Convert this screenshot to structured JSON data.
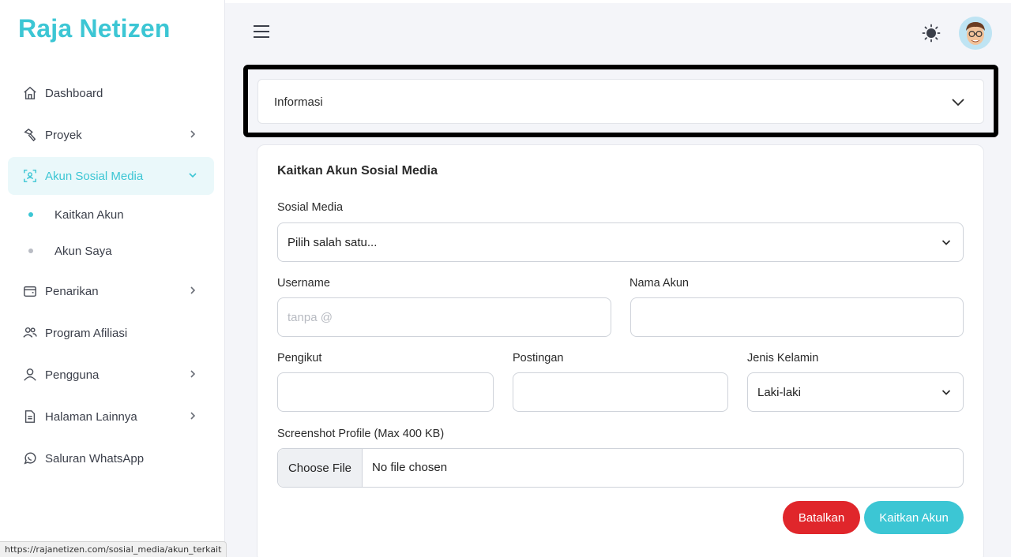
{
  "brand": "Raja Netizen",
  "sidebar": {
    "items": [
      {
        "label": "Dashboard",
        "icon": "home-icon"
      },
      {
        "label": "Proyek",
        "icon": "hammer-icon"
      },
      {
        "label": "Akun Sosial Media",
        "icon": "user-scan-icon"
      },
      {
        "label": "Penarikan",
        "icon": "wallet-icon"
      },
      {
        "label": "Program Afiliasi",
        "icon": "users-icon"
      },
      {
        "label": "Pengguna",
        "icon": "user-icon"
      },
      {
        "label": "Halaman Lainnya",
        "icon": "document-icon"
      },
      {
        "label": "Saluran WhatsApp",
        "icon": "whatsapp-icon"
      }
    ],
    "subitems": [
      {
        "label": "Kaitkan Akun"
      },
      {
        "label": "Akun Saya"
      }
    ]
  },
  "status_url": "https://rajanetizen.com/sosial_media/akun_terkait",
  "accordion": {
    "label": "Informasi"
  },
  "form": {
    "title": "Kaitkan Akun Sosial Media",
    "social_media": {
      "label": "Sosial Media",
      "value": "Pilih salah satu..."
    },
    "username": {
      "label": "Username",
      "placeholder": "tanpa @"
    },
    "account_name": {
      "label": "Nama Akun",
      "value": ""
    },
    "followers": {
      "label": "Pengikut",
      "value": ""
    },
    "posts": {
      "label": "Postingan",
      "value": ""
    },
    "gender": {
      "label": "Jenis Kelamin",
      "value": "Laki-laki"
    },
    "screenshot": {
      "label": "Screenshot Profile (Max 400 KB)",
      "button": "Choose File",
      "status": "No file chosen"
    },
    "cancel_label": "Batalkan",
    "submit_label": "Kaitkan Akun"
  },
  "colors": {
    "accent": "#3cc6d4",
    "danger": "#e0262b"
  }
}
